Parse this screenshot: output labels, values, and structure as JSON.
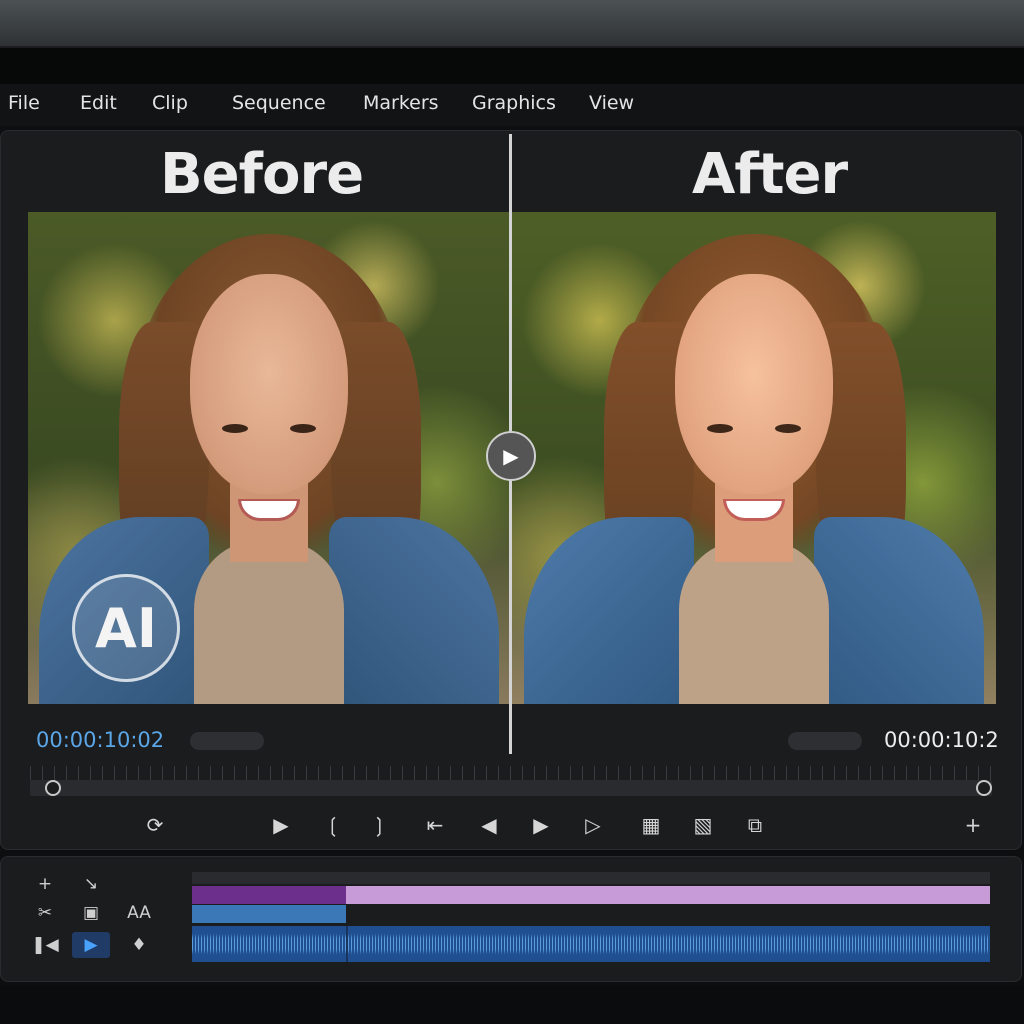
{
  "menu": {
    "items": [
      "File",
      "Edit",
      "Clip",
      "Sequence",
      "Markers",
      "Graphics",
      "View"
    ]
  },
  "monitor": {
    "before_label": "Before",
    "after_label": "After",
    "ai_badge": "AI",
    "timecode_left": "00:00:10:02",
    "timecode_right": "00:00:10:2",
    "split_handle_icon": "play-icon"
  },
  "transport": {
    "icons": [
      "loop-icon",
      "play-icon",
      "mark-in-icon",
      "mark-out-icon",
      "go-to-in-icon",
      "step-back-icon",
      "play-icon",
      "step-forward-icon",
      "lift-icon",
      "extract-icon",
      "export-frame-icon",
      "add-icon"
    ]
  },
  "timeline": {
    "tools": [
      "add-icon",
      "ripple-icon",
      "razor-icon",
      "lock-icon",
      "text-icon",
      "track-select-icon",
      "selection-icon",
      "pen-icon"
    ],
    "text_tool_label": "AA",
    "colors": {
      "video_clip_dark": "#6c2f8c",
      "video_clip_light": "#c79ad8",
      "linked_clip": "#3a78b8",
      "audio_clip": "#1f4f8f",
      "timecode_accent": "#5aa6e6"
    }
  }
}
